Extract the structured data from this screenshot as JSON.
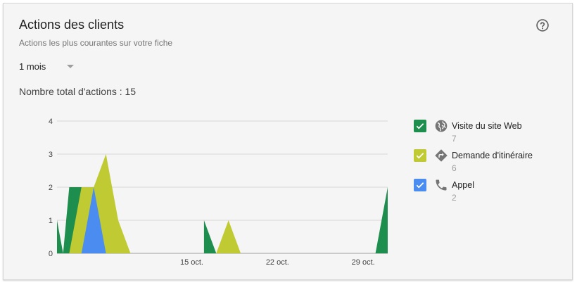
{
  "card": {
    "title": "Actions des clients",
    "subtitle": "Actions les plus courantes sur votre fiche",
    "help_icon": "help-circle-icon"
  },
  "period": {
    "selected": "1 mois"
  },
  "total": {
    "label": "Nombre total d'actions : 15"
  },
  "legend": [
    {
      "name": "Visite du site Web",
      "count": "7",
      "icon": "globe-icon",
      "color": "#1e8e4e",
      "checked": true
    },
    {
      "name": "Demande d'itinéraire",
      "count": "6",
      "icon": "directions-icon",
      "color": "#c0ca33",
      "checked": true
    },
    {
      "name": "Appel",
      "count": "2",
      "icon": "phone-icon",
      "color": "#4a8cf0",
      "checked": true
    }
  ],
  "chart_data": {
    "type": "area",
    "x_ticks": [
      {
        "label": "15 oct.",
        "day": 15
      },
      {
        "label": "22 oct.",
        "day": 22
      },
      {
        "label": "29 oct.",
        "day": 29
      }
    ],
    "y_ticks": [
      "0",
      "1",
      "2",
      "3",
      "4"
    ],
    "ylim": [
      0,
      4
    ],
    "x_start": "2 oct.",
    "x_end": "31 oct.",
    "series": [
      {
        "name": "Visite du site Web",
        "color": "#1e8e4e",
        "points": [
          [
            0,
            1
          ],
          [
            0.5,
            0
          ],
          [
            1,
            2
          ],
          [
            2,
            2
          ],
          [
            3,
            0
          ],
          [
            3,
            0
          ],
          [
            12,
            0
          ],
          [
            12,
            0
          ],
          [
            12,
            1
          ],
          [
            13,
            0
          ],
          [
            26,
            0
          ],
          [
            27,
            2
          ],
          [
            27,
            0
          ]
        ]
      },
      {
        "name": "Demande d'itinéraire",
        "color": "#c0ca33",
        "points": [
          [
            1,
            0
          ],
          [
            2,
            2
          ],
          [
            3,
            2
          ],
          [
            4,
            3
          ],
          [
            5,
            1
          ],
          [
            6,
            0
          ],
          [
            13,
            0
          ],
          [
            14,
            1
          ],
          [
            15,
            0
          ]
        ]
      },
      {
        "name": "Appel",
        "color": "#4a8cf0",
        "points": [
          [
            2,
            0
          ],
          [
            3,
            2
          ],
          [
            4,
            0
          ]
        ]
      }
    ]
  }
}
